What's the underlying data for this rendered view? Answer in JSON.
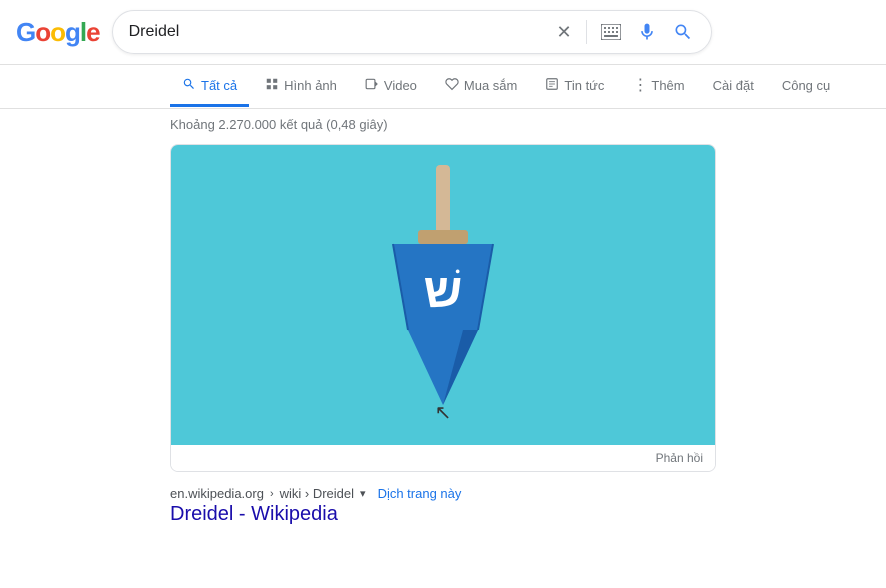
{
  "header": {
    "logo": "Google",
    "search_query": "Dreidel"
  },
  "search_icons": {
    "clear": "✕",
    "keyboard": "⌨",
    "mic": "🎤",
    "search": "🔍"
  },
  "nav": {
    "tabs": [
      {
        "id": "all",
        "label": "Tất cả",
        "icon": "🔍",
        "active": true
      },
      {
        "id": "images",
        "label": "Hình ảnh",
        "icon": "🖼",
        "active": false
      },
      {
        "id": "video",
        "label": "Video",
        "icon": "▶",
        "active": false
      },
      {
        "id": "shopping",
        "label": "Mua sắm",
        "icon": "♡",
        "active": false
      },
      {
        "id": "news",
        "label": "Tin tức",
        "icon": "📰",
        "active": false
      },
      {
        "id": "more",
        "label": "Thêm",
        "icon": "⋮",
        "active": false
      }
    ],
    "settings_label": "Cài đặt",
    "tools_label": "Công cụ"
  },
  "results": {
    "count_text": "Khoảng 2.270.000 kết quả (0,48 giây)"
  },
  "featured": {
    "feedback_label": "Phản hồi"
  },
  "search_result": {
    "url_domain": "en.wikipedia.org",
    "url_path": "wiki › Dreidel",
    "translate_label": "Dịch trang này",
    "title": "Dreidel - Wikipedia",
    "title_href": "https://en.wikipedia.org/wiki/Dreidel"
  },
  "colors": {
    "teal_bg": "#4EC8D8",
    "dreidel_blue": "#2575C4",
    "dreidel_dark": "#1A5CA8",
    "dreidel_stem": "#D4B896",
    "active_tab": "#1a73e8"
  }
}
